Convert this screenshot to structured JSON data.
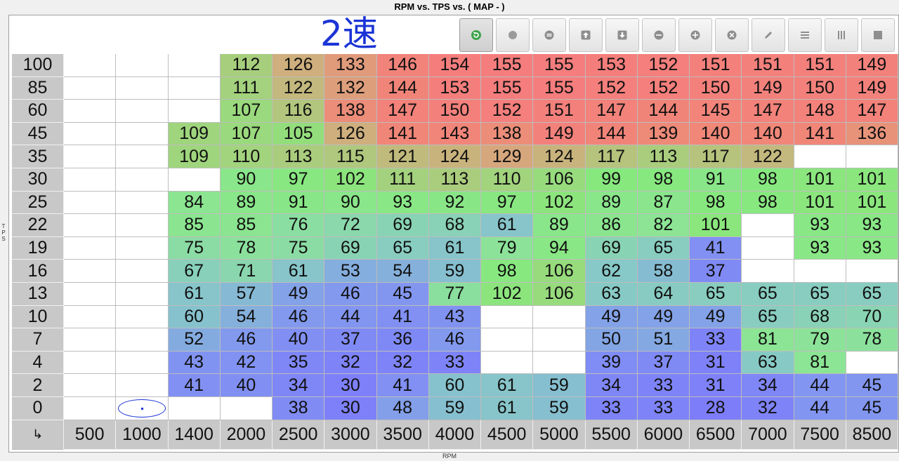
{
  "window": {
    "title": "RPM vs. TPS vs. ( MAP -   )",
    "gear_label": "2速"
  },
  "axes": {
    "y_label": "TPS",
    "x_label": "RPM"
  },
  "toolbar": {
    "buttons": [
      {
        "icon": "refresh-icon",
        "active": true
      },
      {
        "icon": "circle-icon",
        "active": false
      },
      {
        "icon": "equals-circle-icon",
        "active": false
      },
      {
        "icon": "arrow-up-square-icon",
        "active": false
      },
      {
        "icon": "arrow-down-square-icon",
        "active": false
      },
      {
        "icon": "minus-circle-icon",
        "active": false
      },
      {
        "icon": "plus-circle-icon",
        "active": false
      },
      {
        "icon": "x-circle-icon",
        "active": false
      },
      {
        "icon": "pencil-icon",
        "active": false
      },
      {
        "icon": "horizontal-lines-icon",
        "active": false
      },
      {
        "icon": "vertical-lines-icon",
        "active": false
      },
      {
        "icon": "square-icon",
        "active": false
      }
    ]
  },
  "corner_symbol": "↳",
  "cursor_cell": {
    "row": 15,
    "col": 1
  },
  "table": {
    "rpm": [
      "500",
      "1000",
      "1400",
      "2000",
      "2500",
      "3000",
      "3500",
      "4000",
      "4500",
      "5000",
      "5500",
      "6000",
      "6500",
      "7000",
      "7500",
      "8500"
    ],
    "tps": [
      "100",
      "85",
      "60",
      "45",
      "35",
      "30",
      "25",
      "22",
      "19",
      "16",
      "13",
      "10",
      "7",
      "4",
      "2",
      "0"
    ],
    "rows": [
      [
        "",
        "",
        "",
        "112",
        "126",
        "133",
        "146",
        "154",
        "155",
        "155",
        "153",
        "152",
        "151",
        "151",
        "151",
        "149"
      ],
      [
        "",
        "",
        "",
        "111",
        "122",
        "132",
        "144",
        "153",
        "155",
        "155",
        "152",
        "152",
        "150",
        "149",
        "150",
        "149"
      ],
      [
        "",
        "",
        "",
        "107",
        "116",
        "138",
        "147",
        "150",
        "152",
        "151",
        "147",
        "144",
        "145",
        "147",
        "148",
        "147"
      ],
      [
        "",
        "",
        "109",
        "107",
        "105",
        "126",
        "141",
        "143",
        "138",
        "149",
        "144",
        "139",
        "140",
        "140",
        "141",
        "136"
      ],
      [
        "",
        "",
        "109",
        "110",
        "113",
        "115",
        "121",
        "124",
        "129",
        "124",
        "117",
        "113",
        "117",
        "122",
        "",
        ""
      ],
      [
        "",
        "",
        "",
        "90",
        "97",
        "102",
        "111",
        "113",
        "110",
        "106",
        "99",
        "98",
        "91",
        "98",
        "101",
        "101"
      ],
      [
        "",
        "",
        "84",
        "89",
        "91",
        "90",
        "93",
        "92",
        "97",
        "102",
        "89",
        "87",
        "98",
        "98",
        "101",
        "101"
      ],
      [
        "",
        "",
        "85",
        "85",
        "76",
        "72",
        "69",
        "68",
        "61",
        "89",
        "86",
        "82",
        "101",
        "",
        "93",
        "93"
      ],
      [
        "",
        "",
        "75",
        "78",
        "75",
        "69",
        "65",
        "61",
        "79",
        "94",
        "69",
        "65",
        "41",
        "",
        "93",
        "93"
      ],
      [
        "",
        "",
        "67",
        "71",
        "61",
        "53",
        "54",
        "59",
        "98",
        "106",
        "62",
        "58",
        "37",
        "",
        "",
        ""
      ],
      [
        "",
        "",
        "61",
        "57",
        "49",
        "46",
        "45",
        "77",
        "102",
        "106",
        "63",
        "64",
        "65",
        "65",
        "65",
        "65"
      ],
      [
        "",
        "",
        "60",
        "54",
        "46",
        "44",
        "41",
        "43",
        "",
        "",
        "49",
        "49",
        "49",
        "65",
        "68",
        "70"
      ],
      [
        "",
        "",
        "52",
        "46",
        "40",
        "37",
        "36",
        "46",
        "",
        "",
        "50",
        "51",
        "33",
        "81",
        "79",
        "78"
      ],
      [
        "",
        "",
        "43",
        "42",
        "35",
        "32",
        "32",
        "33",
        "",
        "",
        "39",
        "37",
        "31",
        "63",
        "81",
        ""
      ],
      [
        "",
        "",
        "41",
        "40",
        "34",
        "30",
        "41",
        "60",
        "61",
        "59",
        "34",
        "33",
        "31",
        "34",
        "44",
        "45"
      ],
      [
        "",
        "",
        "",
        "",
        "38",
        "30",
        "48",
        "59",
        "61",
        "59",
        "33",
        "33",
        "28",
        "32",
        "44",
        "45"
      ]
    ]
  }
}
